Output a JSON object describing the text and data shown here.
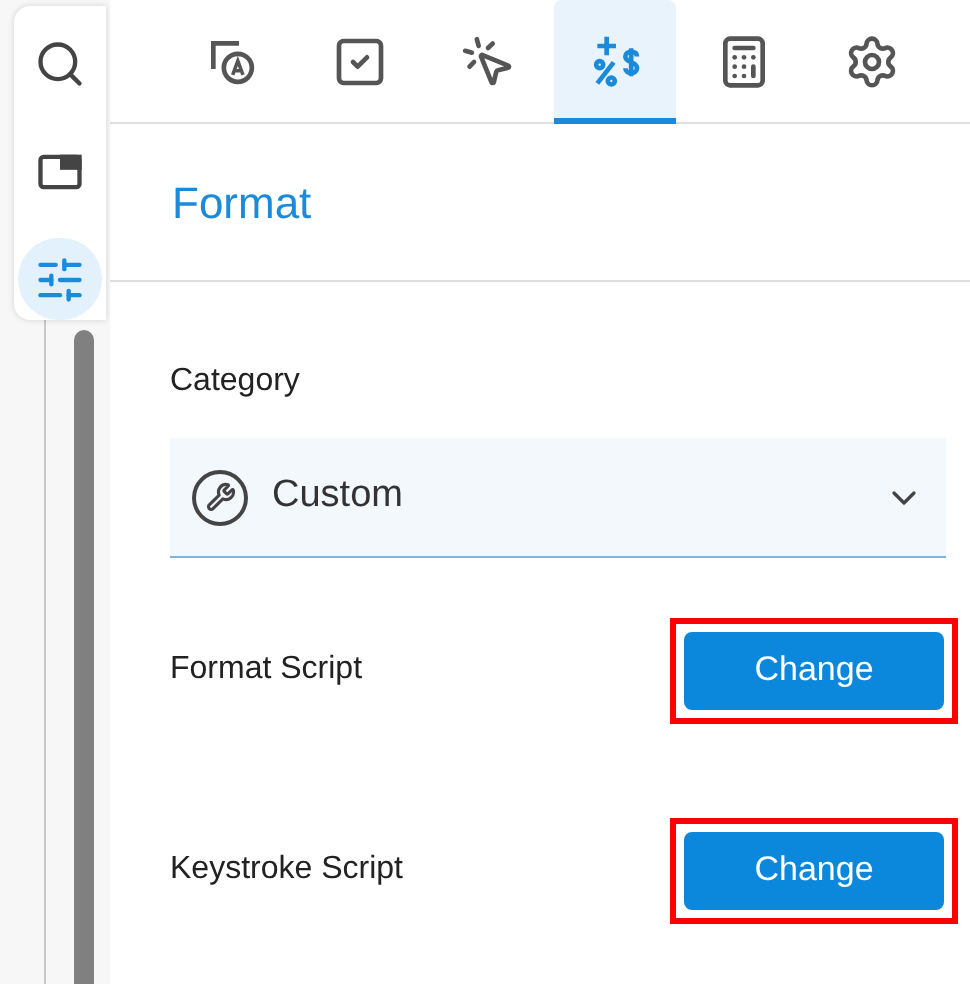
{
  "rail": [
    {
      "selected": false
    },
    {
      "selected": false
    },
    {
      "selected": true
    }
  ],
  "tabs": [
    {
      "selected": false
    },
    {
      "selected": false
    },
    {
      "selected": false
    },
    {
      "selected": true
    },
    {
      "selected": false
    },
    {
      "selected": false
    }
  ],
  "panel": {
    "title": "Format"
  },
  "category": {
    "label": "Category",
    "value": "Custom"
  },
  "scripts": [
    {
      "label": "Format Script",
      "button": "Change",
      "highlighted": true
    },
    {
      "label": "Keystroke Script",
      "button": "Change",
      "highlighted": true
    }
  ]
}
